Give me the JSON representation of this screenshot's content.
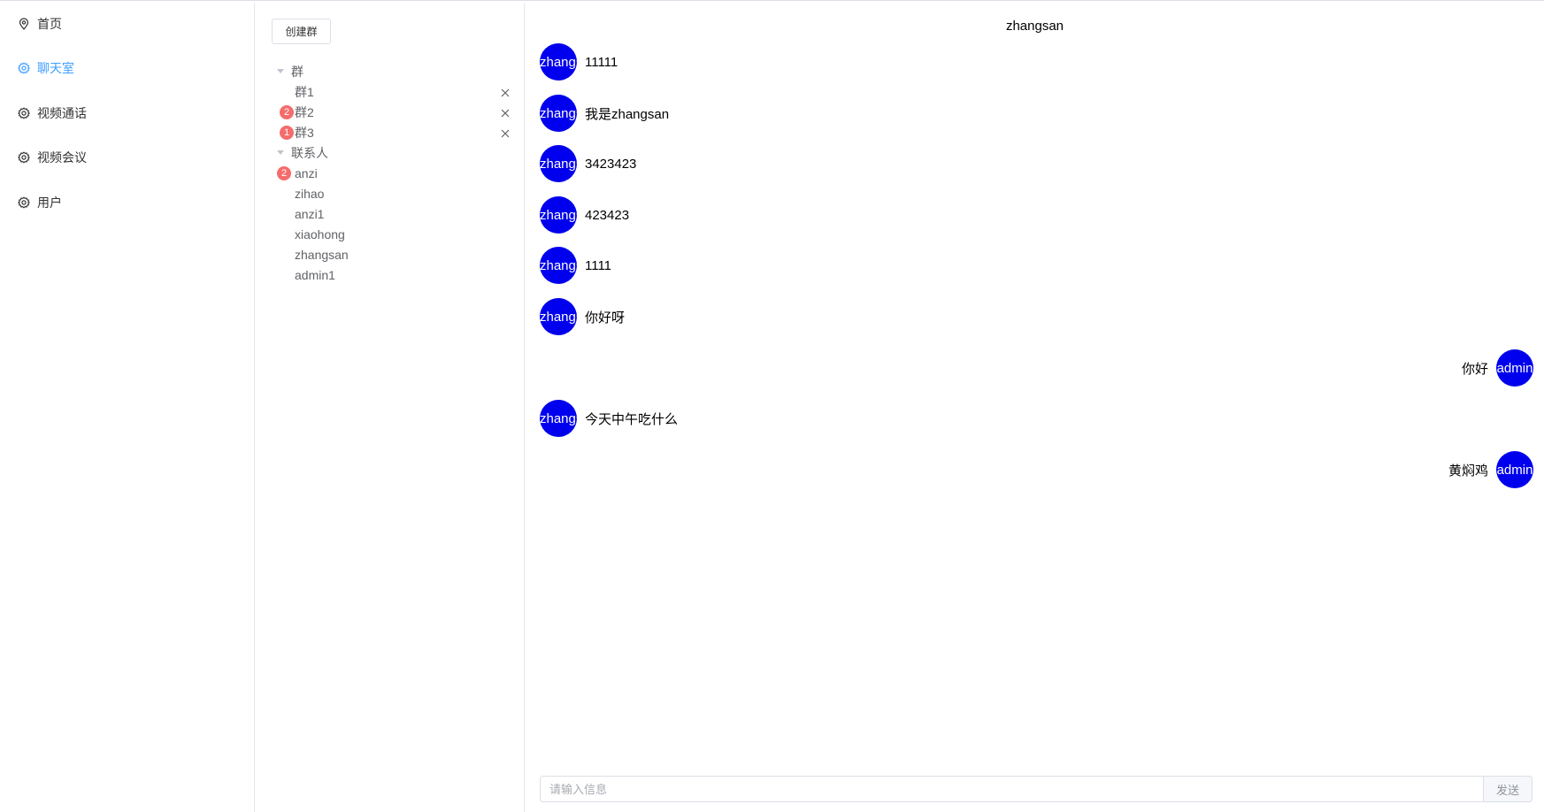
{
  "nav": {
    "items": [
      {
        "label": "首页",
        "icon": "location-icon",
        "active": false
      },
      {
        "label": "聊天室",
        "icon": "gear-icon",
        "active": true
      },
      {
        "label": "视频通话",
        "icon": "gear-icon",
        "active": false
      },
      {
        "label": "视频会议",
        "icon": "gear-icon",
        "active": false
      },
      {
        "label": "用户",
        "icon": "gear-icon",
        "active": false
      }
    ]
  },
  "middle": {
    "create_group_label": "创建群",
    "groups_label": "群",
    "groups": [
      {
        "name": "群1",
        "badge": ""
      },
      {
        "name": "群2",
        "badge": "2"
      },
      {
        "name": "群3",
        "badge": "1"
      }
    ],
    "contacts_label": "联系人",
    "contacts": [
      {
        "name": "anzi",
        "badge": "2"
      },
      {
        "name": "zihao",
        "badge": ""
      },
      {
        "name": "anzi1",
        "badge": ""
      },
      {
        "name": "xiaohong",
        "badge": ""
      },
      {
        "name": "zhangsan",
        "badge": ""
      },
      {
        "name": "admin1",
        "badge": ""
      }
    ]
  },
  "chat": {
    "title": "zhangsan",
    "messages": [
      {
        "from": "zhangsan",
        "avatar": "zhangsan",
        "side": "left",
        "text": "11111"
      },
      {
        "from": "zhangsan",
        "avatar": "zhangsan",
        "side": "left",
        "text": "我是zhangsan"
      },
      {
        "from": "zhangsan",
        "avatar": "zhangsan",
        "side": "left",
        "text": "3423423"
      },
      {
        "from": "zhangsan",
        "avatar": "zhangsan",
        "side": "left",
        "text": "423423"
      },
      {
        "from": "zhangsan",
        "avatar": "zhangsan",
        "side": "left",
        "text": "1111"
      },
      {
        "from": "zhangsan",
        "avatar": "zhangsan",
        "side": "left",
        "text": "你好呀"
      },
      {
        "from": "admin",
        "avatar": "admin",
        "side": "right",
        "text": "你好"
      },
      {
        "from": "zhangsan",
        "avatar": "zhangsan",
        "side": "left",
        "text": "今天中午吃什么"
      },
      {
        "from": "admin",
        "avatar": "admin",
        "side": "right",
        "text": "黄焖鸡"
      }
    ],
    "input_placeholder": "请输入信息",
    "input_value": "",
    "send_label": "发送"
  },
  "colors": {
    "accent": "#409eff",
    "avatar_bg": "#0000ee",
    "badge": "#f56c6c"
  }
}
